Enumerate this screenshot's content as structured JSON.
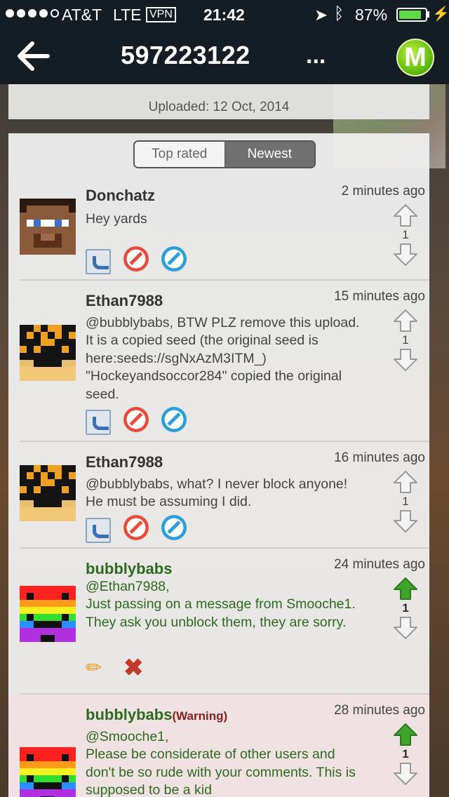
{
  "status_bar": {
    "carrier": "AT&T",
    "network": "LTE",
    "vpn": "VPN",
    "time": "21:42",
    "battery": "87%",
    "battery_level": 0.87
  },
  "nav": {
    "title": "597223122",
    "more": "...",
    "logo_letter": "M"
  },
  "upload": {
    "uploaded_text": "Uploaded: 12 Oct, 2014"
  },
  "sort": {
    "top_rated": "Top rated",
    "newest": "Newest",
    "selected": "Newest"
  },
  "comments": [
    {
      "author": "Donchatz",
      "time": "2 minutes ago",
      "body": "Hey yards",
      "score": "1"
    },
    {
      "author": "Ethan7988",
      "time": "15 minutes ago",
      "body": "@bubblybabs, BTW PLZ remove this upload. It is a copied seed (the original seed is here:seeds://sgNxAzM3ITM_) \"Hockeyandsoccor284\" copied the original seed.",
      "score": "1"
    },
    {
      "author": "Ethan7988",
      "time": "16 minutes ago",
      "body": "@bubblybabs, what? I never block anyone! He must be assuming I did.",
      "score": "1"
    },
    {
      "author": "bubblybabs",
      "time": "24 minutes ago",
      "body": "@Ethan7988,\nJust passing on a message from Smooche1. They ask you unblock them, they are sorry.",
      "score": "1"
    },
    {
      "author": "bubblybabs",
      "tag": "(Warning)",
      "time": "28 minutes ago",
      "body": "@Smooche1,\nPlease be considerate of other users and don't be so rude with your comments. This is supposed to be a kid",
      "score": "1"
    }
  ],
  "colors": {
    "nav_bg": "#141c24",
    "own_comment_text": "#2e6a1f",
    "upvote_active": "#3fa52a",
    "warning_bg": "#f0e2e2"
  },
  "icons": [
    "back-arrow-icon",
    "logo-m-icon",
    "reply-icon",
    "block-icon",
    "report-icon",
    "edit-pencil-icon",
    "delete-x-icon",
    "upvote-arrow-icon",
    "downvote-arrow-icon"
  ]
}
